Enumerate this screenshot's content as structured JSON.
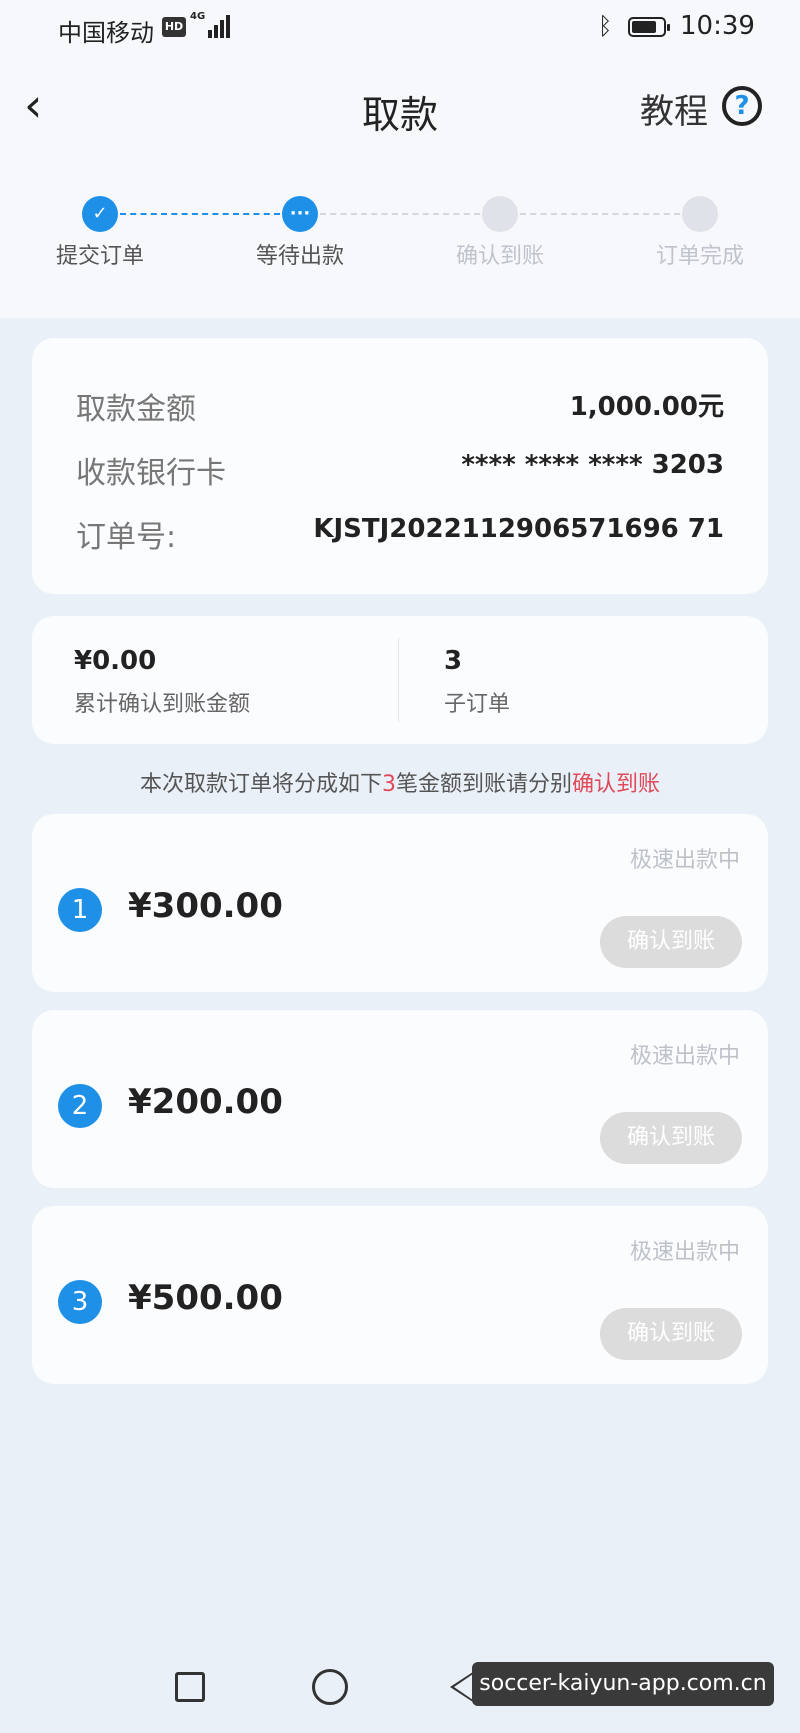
{
  "status_bar": {
    "carrier": "中国移动",
    "hd": "HD",
    "network": "4G",
    "bluetooth_icon": "bluetooth-icon",
    "battery_level": 0.8,
    "time": "10:39"
  },
  "header": {
    "back_icon": "chevron-left-icon",
    "title": "取款",
    "tutorial_label": "教程",
    "help_icon": "question-circle-icon"
  },
  "steps": [
    {
      "label": "提交订单",
      "state": "done",
      "icon": "check-icon"
    },
    {
      "label": "等待出款",
      "state": "current",
      "icon": "ellipsis-icon"
    },
    {
      "label": "确认到账",
      "state": "pending"
    },
    {
      "label": "订单完成",
      "state": "pending"
    }
  ],
  "order": {
    "amount_label": "取款金额",
    "amount_value": "1,000.00元",
    "card_label": "收款银行卡",
    "card_value": "**** **** **** 3203",
    "order_label": "订单号:",
    "order_value": "KJSTJ2022112906571696 71"
  },
  "stats": {
    "confirmed_amount": "¥0.00",
    "confirmed_label": "累计确认到账金额",
    "sub_count": "3",
    "sub_label": "子订单"
  },
  "notice": {
    "prefix": "本次取款订单将分成如下",
    "count": "3",
    "middle": "笔金额到账请分别",
    "link": "确认到账"
  },
  "sub_orders": [
    {
      "index": "1",
      "amount": "¥300.00",
      "status": "极速出款中",
      "button": "确认到账"
    },
    {
      "index": "2",
      "amount": "¥200.00",
      "status": "极速出款中",
      "button": "确认到账"
    },
    {
      "index": "3",
      "amount": "¥500.00",
      "status": "极速出款中",
      "button": "确认到账"
    }
  ],
  "colors": {
    "accent": "#1e90e8",
    "highlight": "#e04a5a",
    "disabled_button": "#dcdcdc"
  },
  "watermark": "soccer-kaiyun-app.com.cn"
}
